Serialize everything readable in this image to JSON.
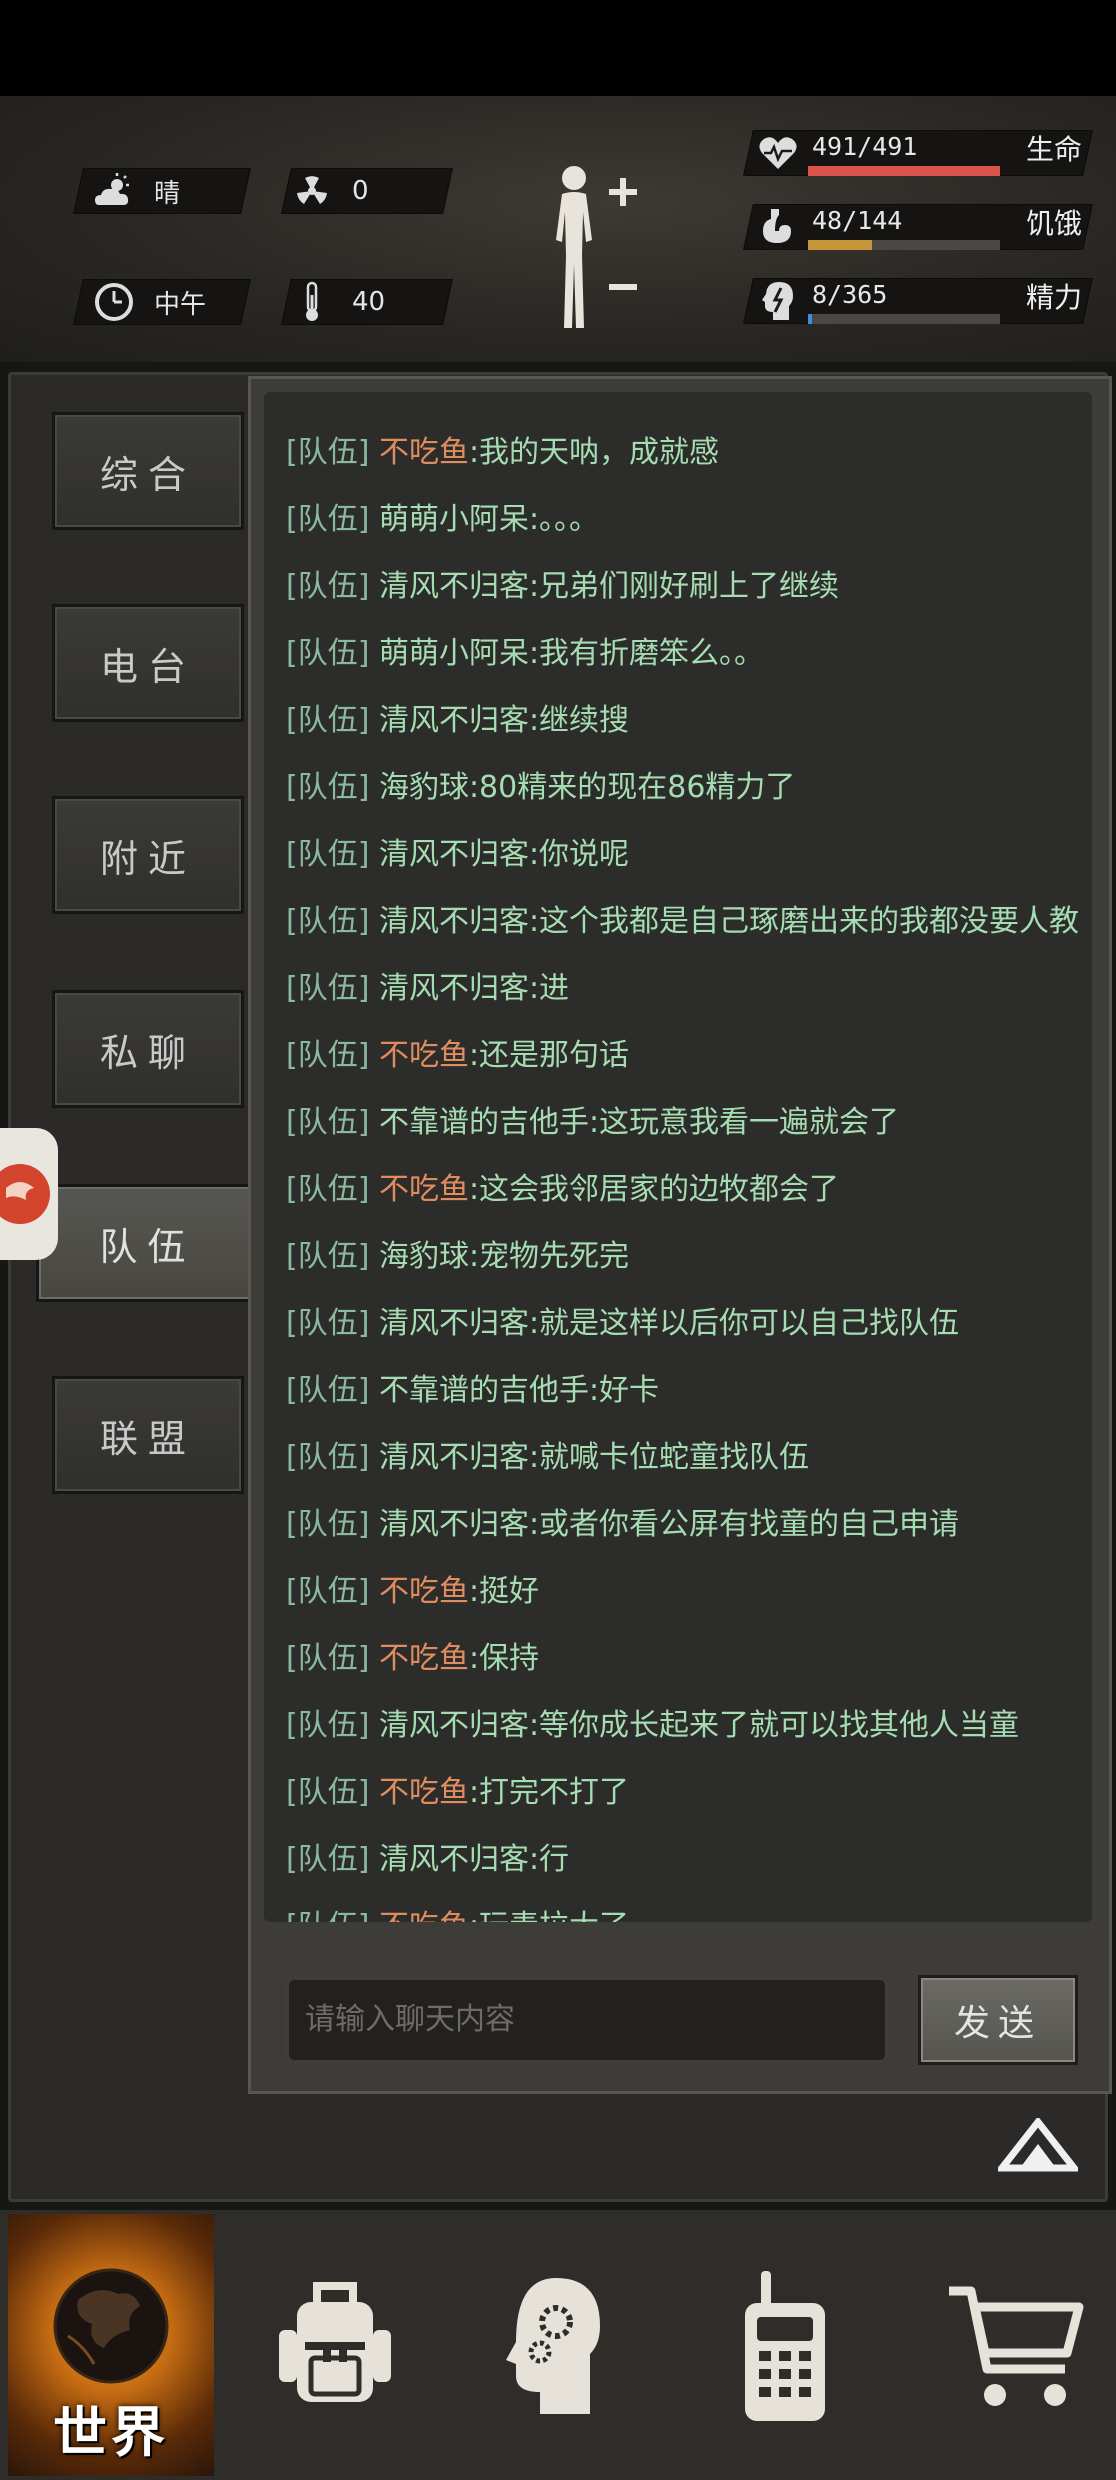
{
  "header": {
    "weather": "晴",
    "radiation": "0",
    "time_of_day": "中午",
    "temperature": "40",
    "stats": [
      {
        "label": "生命",
        "value": "491/491",
        "fraction": 1.0,
        "color": "#d9534a"
      },
      {
        "label": "饥饿",
        "value": "48/144",
        "fraction": 0.333,
        "color": "#c8963a"
      },
      {
        "label": "精力",
        "value": "8/365",
        "fraction": 0.022,
        "color": "#3f8fd6"
      }
    ]
  },
  "tabs": [
    {
      "label": "综合",
      "active": false
    },
    {
      "label": "电台",
      "active": false
    },
    {
      "label": "附近",
      "active": false
    },
    {
      "label": "私聊",
      "active": false
    },
    {
      "label": "队伍",
      "active": true
    },
    {
      "label": "联盟",
      "active": false
    }
  ],
  "chat": {
    "channel_tag": "[队伍]",
    "messages": [
      {
        "name": "不吃鱼",
        "text": ":我的天呐，成就感",
        "highlight": true
      },
      {
        "name": "萌萌小阿呆",
        "text": ":。。。",
        "highlight": false
      },
      {
        "name": "清风不归客",
        "text": ":兄弟们刚好刷上了继续",
        "highlight": false
      },
      {
        "name": "萌萌小阿呆",
        "text": ":我有折磨笨么。。",
        "highlight": false
      },
      {
        "name": "清风不归客",
        "text": ":继续搜",
        "highlight": false
      },
      {
        "name": "海豹球",
        "text": ":80精来的现在86精力了",
        "highlight": false
      },
      {
        "name": "清风不归客",
        "text": ":你说呢",
        "highlight": false
      },
      {
        "name": "清风不归客",
        "text": ":这个我都是自己琢磨出来的我都没要人教",
        "highlight": false
      },
      {
        "name": "清风不归客",
        "text": ":进",
        "highlight": false
      },
      {
        "name": "不吃鱼",
        "text": ":还是那句话",
        "highlight": true
      },
      {
        "name": "不靠谱的吉他手",
        "text": ":这玩意我看一遍就会了",
        "highlight": false
      },
      {
        "name": "不吃鱼",
        "text": ":这会我邻居家的边牧都会了",
        "highlight": true
      },
      {
        "name": "海豹球",
        "text": ":宠物先死完",
        "highlight": false
      },
      {
        "name": "清风不归客",
        "text": ":就是这样以后你可以自己找队伍",
        "highlight": false
      },
      {
        "name": "不靠谱的吉他手",
        "text": ":好卡",
        "highlight": false
      },
      {
        "name": "清风不归客",
        "text": ":就喊卡位蛇童找队伍",
        "highlight": false
      },
      {
        "name": "清风不归客",
        "text": ":或者你看公屏有找童的自己申请",
        "highlight": false
      },
      {
        "name": "不吃鱼",
        "text": ":挺好",
        "highlight": true
      },
      {
        "name": "不吃鱼",
        "text": ":保持",
        "highlight": true
      },
      {
        "name": "清风不归客",
        "text": ":等你成长起来了就可以找其他人当童",
        "highlight": false
      },
      {
        "name": "不吃鱼",
        "text": ":打完不打了",
        "highlight": true
      },
      {
        "name": "清风不归客",
        "text": ":行",
        "highlight": false
      },
      {
        "name": "不吃鱼",
        "text": ":玩毒拉大了",
        "highlight": true
      }
    ],
    "input_placeholder": "请输入聊天内容",
    "send_label": "发送"
  },
  "bottom_nav": {
    "world_label": "世界",
    "items": [
      {
        "icon": "globe-icon",
        "label": "世界",
        "active": true
      },
      {
        "icon": "backpack-icon"
      },
      {
        "icon": "head-gears-icon"
      },
      {
        "icon": "walkie-talkie-icon"
      },
      {
        "icon": "shopping-cart-icon"
      }
    ]
  }
}
